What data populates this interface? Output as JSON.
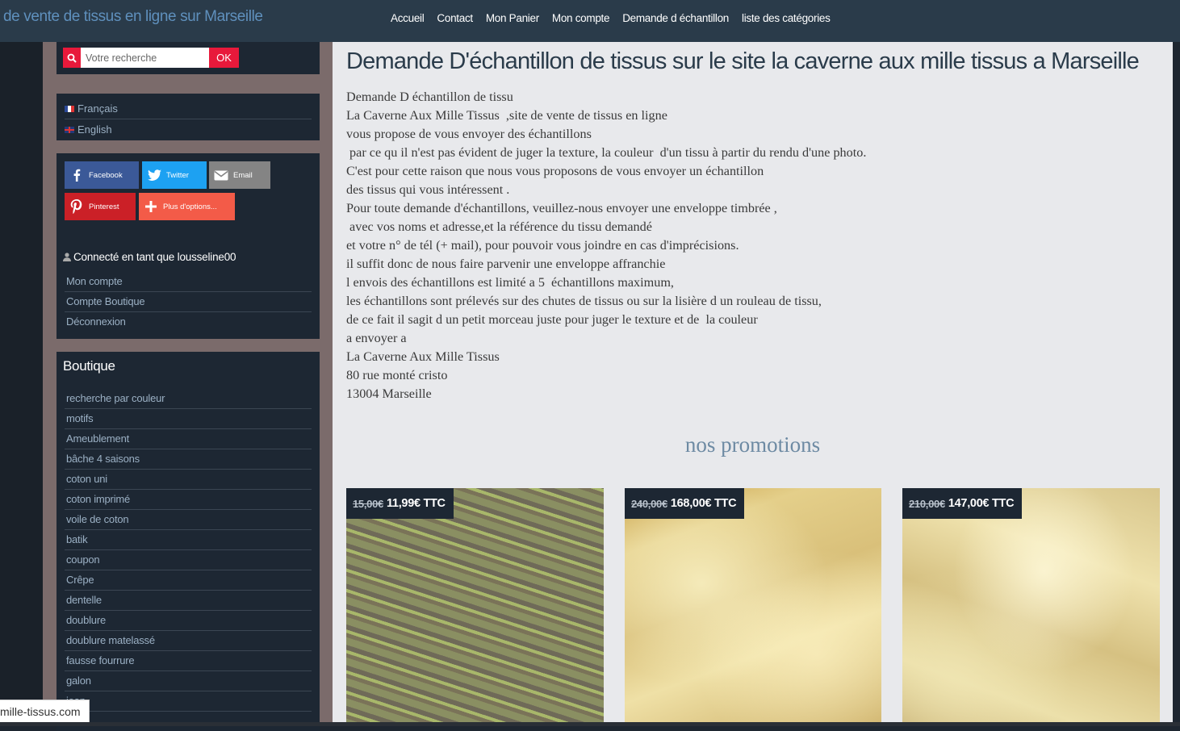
{
  "header": {
    "site_title": "de vente de tissus en ligne sur Marseille",
    "nav": [
      "Accueil",
      "Contact",
      "Mon Panier",
      "Mon compte",
      "Demande d échantillon",
      "liste des catégories"
    ]
  },
  "sidebar": {
    "search": {
      "placeholder": "Votre recherche",
      "button": "OK"
    },
    "languages": [
      "Français",
      "English"
    ],
    "share": {
      "facebook": "Facebook",
      "twitter": "Twitter",
      "email": "Email",
      "pinterest": "Pinterest",
      "more": "Plus d'options..."
    },
    "account": {
      "connected": "Connecté en tant que lousseline00",
      "links": [
        "Mon compte",
        "Compte Boutique",
        "Déconnexion"
      ]
    },
    "shop": {
      "title": "Boutique",
      "categories": [
        "recherche par couleur",
        "motifs",
        "Ameublement",
        "bâche 4 saisons",
        "coton uni",
        "coton imprimé",
        "voile de coton",
        "batik",
        "coupon",
        "Crêpe",
        "dentelle",
        "doublure",
        "doublure matelassé",
        "fausse fourrure",
        "galon",
        "jean"
      ]
    }
  },
  "main": {
    "title": "Demande D'échantillon de tissus sur le site la caverne aux mille tissus a Marseille",
    "lines": [
      "Demande D échantillon de tissu",
      "La Caverne Aux Mille Tissus  ,site de vente de tissus en ligne",
      "vous propose de vous envoyer des échantillons",
      " par ce qu il n'est pas évident de juger la texture, la couleur  d'un tissu à partir du rendu d'une photo.",
      "C'est pour cette raison que nous vous proposons de vous envoyer un échantillon",
      "des tissus qui vous intéressent .",
      "Pour toute demande d'échantillons, veuillez-nous envoyer une enveloppe timbrée ,",
      " avec vos noms et adresse,et la référence du tissu demandé",
      "et votre n° de tél (+ mail), pour pouvoir vous joindre en cas d'imprécisions.",
      "il suffit donc de nous faire parvenir une enveloppe affranchie",
      "l envois des échantillons est limité a 5  échantillons maximum,",
      "les échantillons sont prélevés sur des chutes de tissus ou sur la lisière d un rouleau de tissu,",
      "de ce fait il sagit d un petit morceau juste pour juger le texture et de  la couleur",
      "a envoyer a",
      "La Caverne Aux Mille Tissus",
      "80 rue monté cristo",
      "13004 Marseille"
    ],
    "promo_heading": "nos promotions",
    "products": [
      {
        "old_price": "15,00€",
        "price": "11,99€ TTC"
      },
      {
        "old_price": "240,00€",
        "price": "168,00€ TTC"
      },
      {
        "old_price": "210,00€",
        "price": "147,00€ TTC"
      }
    ]
  },
  "status_bar": {
    "url": "mille-tissus.com"
  },
  "colors": {
    "accent_red": "#e8193b",
    "dark_panel": "#1d2733",
    "sidebar_bg": "#7b6b6b",
    "link_blue": "#9bb0c4"
  }
}
